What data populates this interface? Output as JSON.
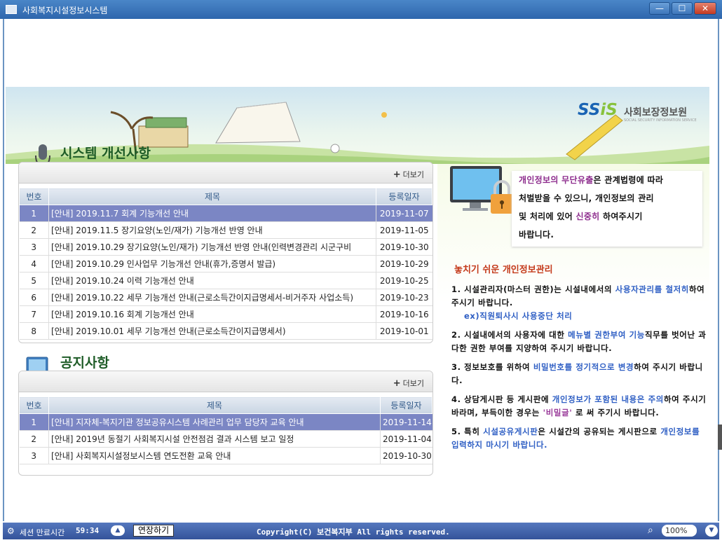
{
  "window": {
    "title": "사회복지시설정보시스템",
    "minimize_icon": "minimize-icon",
    "maximize_icon": "maximize-icon",
    "close_icon": "close-icon"
  },
  "brand": {
    "logo_letters_a": "SS",
    "logo_letters_b": "iS",
    "name": "사회보장정보원",
    "sub": "SOCIAL SECURITY INFORMATION SERVICE"
  },
  "improvements": {
    "title": "시스템 개선사항",
    "more_label": "더보기",
    "columns": [
      "번호",
      "제목",
      "등록일자"
    ],
    "rows": [
      {
        "no": "1",
        "title": "[안내] 2019.11.7 회계 기능개선 안내",
        "date": "2019-11-07"
      },
      {
        "no": "2",
        "title": "[안내] 2019.11.5 장기요양(노인/재가) 기능개선 반영 안내",
        "date": "2019-11-05"
      },
      {
        "no": "3",
        "title": "[안내] 2019.10.29 장기요양(노인/재가) 기능개선 반영 안내(인력변경관리 시군구비",
        "date": "2019-10-30"
      },
      {
        "no": "4",
        "title": "[안내] 2019.10.29 인사업무 기능개선 안내(휴가,증명서 발급)",
        "date": "2019-10-29"
      },
      {
        "no": "5",
        "title": "[안내] 2019.10.24 이력 기능개선 안내",
        "date": "2019-10-25"
      },
      {
        "no": "6",
        "title": "[안내] 2019.10.22 세무 기능개선 안내(근로소득간이지급명세서-비거주자 사업소득)",
        "date": "2019-10-23"
      },
      {
        "no": "7",
        "title": "[안내] 2019.10.16 회계 기능개선 안내",
        "date": "2019-10-16"
      },
      {
        "no": "8",
        "title": "[안내] 2019.10.01 세무 기능개선 안내(근로소득간이지급명세서)",
        "date": "2019-10-01"
      }
    ]
  },
  "notices": {
    "title": "공지사항",
    "more_label": "더보기",
    "columns": [
      "번호",
      "제목",
      "등록일자"
    ],
    "rows": [
      {
        "no": "1",
        "title": "[안내] 지자체-복지기관 정보공유시스템 사례관리 업무 담당자 교육 안내",
        "date": "2019-11-14"
      },
      {
        "no": "2",
        "title": "[안내] 2019년 동절기 사회복지시설 안전점검 결과 시스템 보고 일정",
        "date": "2019-11-04"
      },
      {
        "no": "3",
        "title": "[안내] 사회복지시설정보시스템 연도전환 교육 안내",
        "date": "2019-10-30"
      }
    ]
  },
  "privacy_box": {
    "l1a": "개인정보의 무단유출",
    "l1b": "은 관계법령에 따라",
    "l2": "처벌받을 수 있으니, 개인정보의 관리",
    "l3a": "및 처리에 있어 ",
    "l3b": "신중히",
    "l3c": " 하여주시기",
    "l4": "바랍니다."
  },
  "guide": {
    "title": "놓치기 쉬운 개인정보관리",
    "i1a": "1. 시설관리자(마스터 권한)는 시설내에서의 ",
    "i1b": "사용자관리를 철저히",
    "i1c": "하여주시기 바랍니다.",
    "i1d": "ex)직원퇴사시 사용중단 처리",
    "i2a": "2. 시설내에서의 사용자에 대한 ",
    "i2b": "메뉴별 권한부여 기능",
    "i2c": "직무를 벗어난 과다한 권한 부여를 지양하여 주시기 바랍니다.",
    "i3a": "3. 정보보호를 위하여 ",
    "i3b": "비밀번호를 정기적으로 변경",
    "i3c": "하여 주시기 바랍니다.",
    "i4a": "4. 상담게시판 등 게시판에 ",
    "i4b": "개인정보가 포함된 내용은 주의",
    "i4c": "하여 주시기 바라며, 부득이한 경우는 ",
    "i4d": "'비밀글'",
    "i4e": " 로 써 주기시 바랍니다.",
    "i5a": "5. 특히 ",
    "i5b": "시설공유게시판",
    "i5c": "은 시설간의 공유되는 게시판으로 ",
    "i5d": "개인정보를 입력하지 마시기 바랍니다."
  },
  "status": {
    "session_label": "세션 만료시간",
    "session_time": "59:34",
    "extend_label": "연장하기",
    "copyright": "Copyright(C) 보건복지부 All rights reserved.",
    "zoom": "100%"
  }
}
